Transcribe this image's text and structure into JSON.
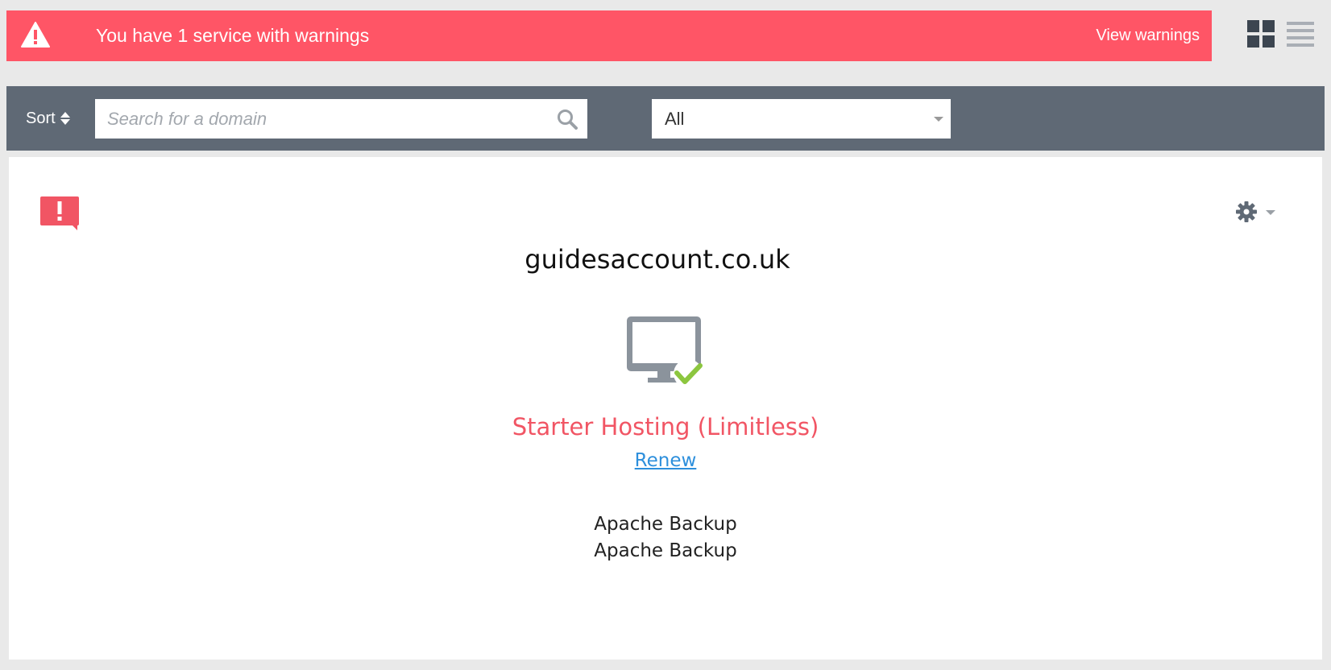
{
  "alert": {
    "message": "You have 1 service with warnings",
    "action_label": "View warnings",
    "icon": "warning-triangle-icon",
    "color": "#ff5566"
  },
  "view_toggle": {
    "grid_icon": "grid-view-icon",
    "list_icon": "list-view-icon"
  },
  "toolbar": {
    "sort_label": "Sort",
    "search_placeholder": "Search for a domain",
    "search_value": "",
    "filter_value": "All",
    "background": "#5f6975"
  },
  "service_card": {
    "domain": "guidesaccount.co.uk",
    "status_icon": "alert-speech-bubble-icon",
    "settings_icon": "gear-icon",
    "service_icon": "monitor-check-icon",
    "product": "Starter Hosting (Limitless)",
    "renew_label": "Renew",
    "addons": [
      "Apache Backup",
      "Apache Backup"
    ],
    "accent": "#f15564",
    "link_color": "#2d8fdc"
  }
}
